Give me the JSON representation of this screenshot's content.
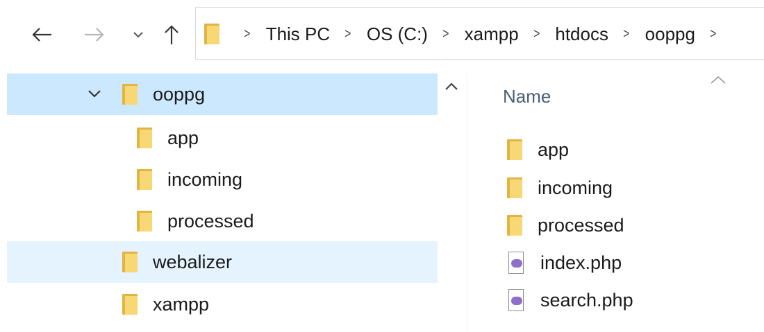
{
  "toolbar": {
    "back_icon": "arrow-left-icon",
    "forward_icon": "arrow-right-icon",
    "recent_icon": "chevron-down-icon",
    "up_icon": "arrow-up-icon"
  },
  "address": {
    "crumbs": [
      "This PC",
      "OS (C:)",
      "xampp",
      "htdocs",
      "ooppg"
    ]
  },
  "tree": {
    "items": [
      {
        "label": "ooppg",
        "expanded": true,
        "selected": true
      },
      {
        "label": "app"
      },
      {
        "label": "incoming"
      },
      {
        "label": "processed"
      },
      {
        "label": "webalizer",
        "hover": true
      },
      {
        "label": "xampp"
      }
    ]
  },
  "files": {
    "column_header": "Name",
    "items": [
      {
        "name": "app",
        "icon": "folder-icon"
      },
      {
        "name": "incoming",
        "icon": "folder-icon"
      },
      {
        "name": "processed",
        "icon": "folder-icon"
      },
      {
        "name": "index.php",
        "icon": "php-file-icon"
      },
      {
        "name": "search.php",
        "icon": "php-file-icon"
      }
    ]
  },
  "colors": {
    "selected_bg": "#cce8ff",
    "hover_bg": "#e5f3ff",
    "folder_front": "#f8d775",
    "folder_back": "#e2b443",
    "header_text": "#4c5f79"
  }
}
